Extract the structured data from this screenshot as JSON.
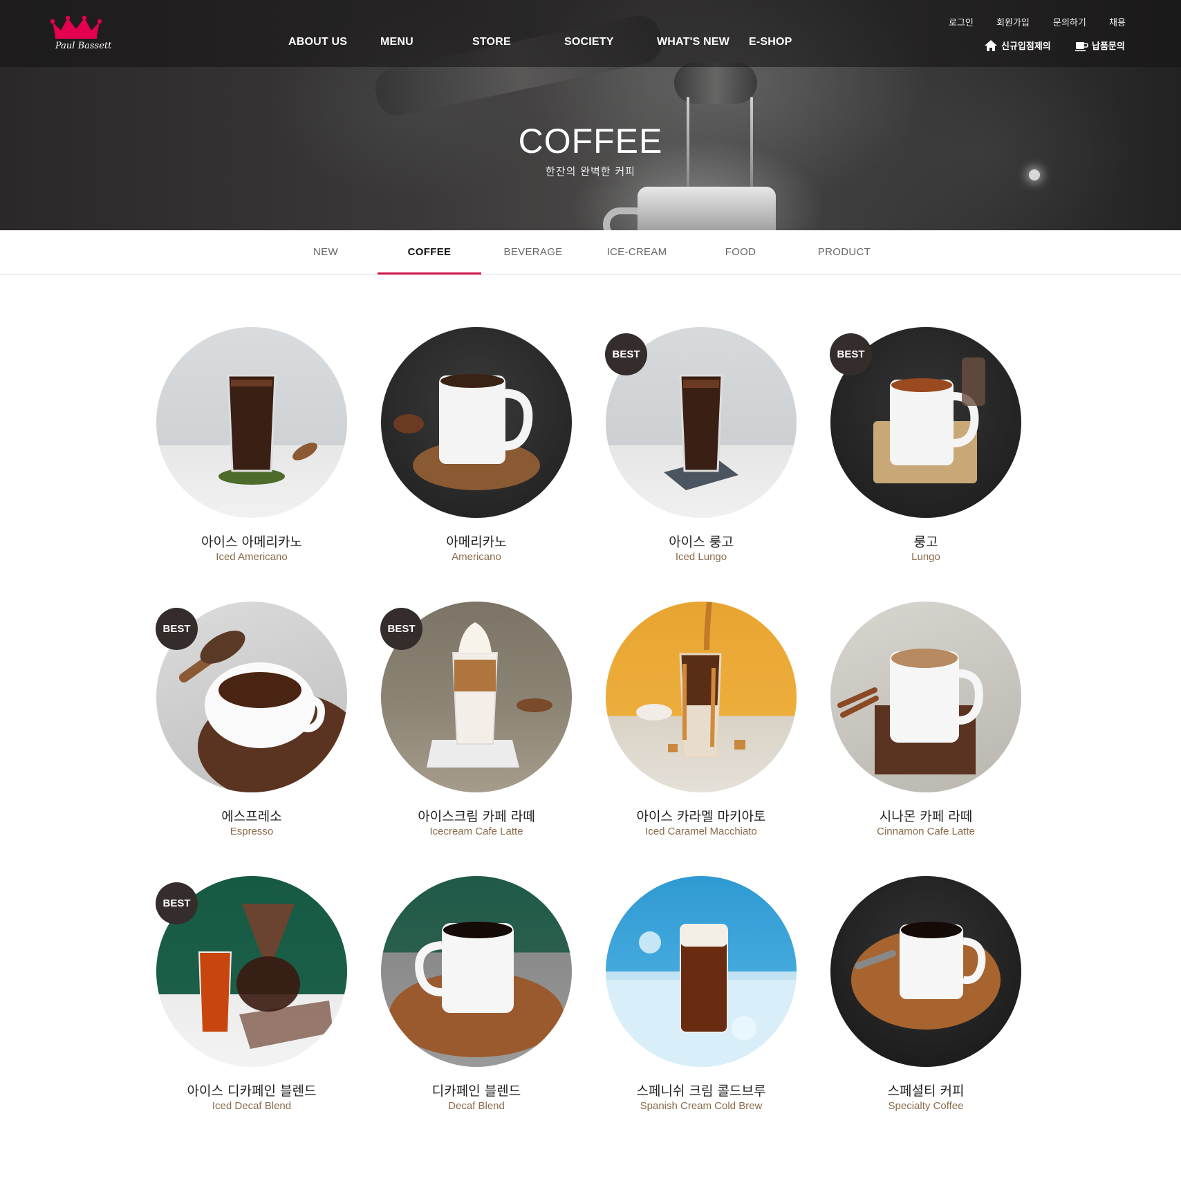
{
  "header": {
    "logo_text": "Paul Bassett",
    "gnb": [
      "ABOUT US",
      "MENU",
      "STORE",
      "SOCIETY",
      "WHAT'S NEW",
      "E-SHOP"
    ],
    "util_links": [
      "로그인",
      "회원가입",
      "문의하기",
      "채용"
    ],
    "util_buttons": [
      "신규입점제의",
      "납품문의"
    ]
  },
  "hero": {
    "title": "COFFEE",
    "subtitle": "한잔의 완벽한 커피"
  },
  "tabs": {
    "items": [
      "NEW",
      "COFFEE",
      "BEVERAGE",
      "ICE-CREAM",
      "FOOD",
      "PRODUCT"
    ],
    "active": "COFFEE"
  },
  "badge_label": "BEST",
  "menu": [
    {
      "ko": "아이스 아메리카노",
      "en": "Iced Americano",
      "best": false
    },
    {
      "ko": "아메리카노",
      "en": "Americano",
      "best": false
    },
    {
      "ko": "아이스 룽고",
      "en": "Iced Lungo",
      "best": true
    },
    {
      "ko": "룽고",
      "en": "Lungo",
      "best": true
    },
    {
      "ko": "에스프레소",
      "en": "Espresso",
      "best": true
    },
    {
      "ko": "아이스크림 카페 라떼",
      "en": "Icecream Cafe Latte",
      "best": true
    },
    {
      "ko": "아이스 카라멜 마키아토",
      "en": "Iced Caramel Macchiato",
      "best": false
    },
    {
      "ko": "시나몬 카페 라떼",
      "en": "Cinnamon Cafe Latte",
      "best": false
    },
    {
      "ko": "아이스 디카페인 블렌드",
      "en": "Iced Decaf Blend",
      "best": true
    },
    {
      "ko": "디카페인 블렌드",
      "en": "Decaf Blend",
      "best": false
    },
    {
      "ko": "스페니쉬 크림 콜드브루",
      "en": "Spanish Cream Cold Brew",
      "best": false
    },
    {
      "ko": "스페셜티 커피",
      "en": "Specialty Coffee",
      "best": false
    }
  ],
  "colors": {
    "accent": "#d4174a",
    "badge": "#352d2b",
    "english_name": "#8a6a4a"
  }
}
